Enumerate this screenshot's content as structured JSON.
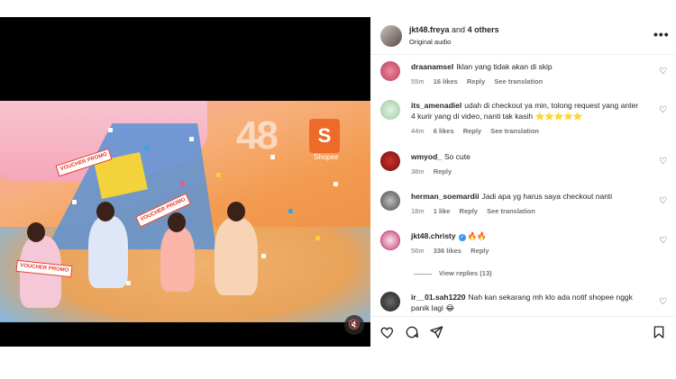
{
  "post": {
    "author": "jkt48.freya",
    "collab_text": "and",
    "collab_count": "4 others",
    "audio": "Original audio",
    "more_icon": "more-horizontal-icon"
  },
  "video": {
    "brand": "Shopee",
    "voucher_text": "VOUCHER PROMO",
    "mute_icon": "speaker-muted-icon"
  },
  "comments": [
    {
      "user": "draanamsel",
      "text": "Iklan yang tidak akan di skip",
      "time": "55m",
      "likes": "16 likes",
      "reply": "Reply",
      "translation": "See translation"
    },
    {
      "user": "its_amenadiel",
      "text": "udah di checkout ya min, tolong request yang anter 4 kurir yang di video, nanti tak kasih ⭐⭐⭐⭐⭐",
      "time": "44m",
      "likes": "6 likes",
      "reply": "Reply",
      "translation": "See translation"
    },
    {
      "user": "wmyod_",
      "text": "So cute",
      "time": "38m",
      "reply": "Reply"
    },
    {
      "user": "herman_soemardii",
      "text": "Jadi apa yg harus saya checkout nanti",
      "time": "18m",
      "likes": "1 like",
      "reply": "Reply",
      "translation": "See translation"
    },
    {
      "user": "jkt48.christy",
      "text": "🔥🔥",
      "time": "56m",
      "likes": "336 likes",
      "reply": "Reply",
      "view_replies": "View replies (13)"
    },
    {
      "user": "ir__01.sah1220",
      "text": "Nah kan sekarang mh klo ada notif shopee nggk panik lagi 😂"
    }
  ],
  "actions": {
    "like_icon": "heart-icon",
    "comment_icon": "comment-icon",
    "share_icon": "send-icon",
    "save_icon": "bookmark-icon"
  }
}
